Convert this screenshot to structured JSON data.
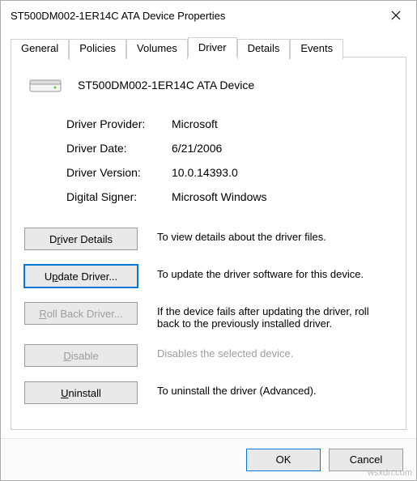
{
  "window": {
    "title": "ST500DM002-1ER14C ATA Device Properties"
  },
  "tabs": {
    "items": [
      {
        "label": "General"
      },
      {
        "label": "Policies"
      },
      {
        "label": "Volumes"
      },
      {
        "label": "Driver"
      },
      {
        "label": "Details"
      },
      {
        "label": "Events"
      }
    ],
    "active_index": 3
  },
  "device": {
    "name": "ST500DM002-1ER14C ATA Device"
  },
  "props": {
    "provider_label": "Driver Provider:",
    "provider_value": "Microsoft",
    "date_label": "Driver Date:",
    "date_value": "6/21/2006",
    "version_label": "Driver Version:",
    "version_value": "10.0.14393.0",
    "signer_label": "Digital Signer:",
    "signer_value": "Microsoft Windows"
  },
  "actions": {
    "details": {
      "pre": "D",
      "u": "r",
      "post": "iver Details",
      "desc": "To view details about the driver files."
    },
    "update": {
      "pre": "U",
      "u": "p",
      "post": "date Driver...",
      "desc": "To update the driver software for this device."
    },
    "rollback": {
      "pre": "",
      "u": "R",
      "post": "oll Back Driver...",
      "desc": "If the device fails after updating the driver, roll back to the previously installed driver."
    },
    "disable": {
      "pre": "",
      "u": "D",
      "post": "isable",
      "desc": "Disables the selected device."
    },
    "uninstall": {
      "pre": "",
      "u": "U",
      "post": "ninstall",
      "desc": "To uninstall the driver (Advanced)."
    }
  },
  "footer": {
    "ok": "OK",
    "cancel": "Cancel"
  },
  "watermark": "wsxdn.com"
}
